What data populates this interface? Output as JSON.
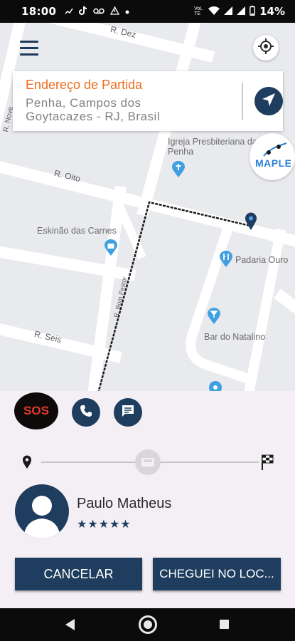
{
  "status_bar": {
    "time": "18:00",
    "left_icons": [
      "signal-bars-icon",
      "tiktok-icon",
      "voicemail-icon",
      "warning-icon",
      "dot-icon"
    ],
    "network": "VoLTE",
    "battery_percent": "14%"
  },
  "map": {
    "street_labels": [
      "R. Dez",
      "R. Oito",
      "R. Seis",
      "R. Nove",
      "R. Bom Pastor"
    ],
    "poi_igreja": "Igreja Presbiteriana da Penha",
    "poi_eskinao": "Eskinão das Carnes",
    "poi_padaria": "Padaria Ouro",
    "poi_bar": "Bar do Natalino",
    "maple_logo_text": "MAPLE"
  },
  "address_card": {
    "title": "Endereço de Partida",
    "address": "Penha, Campos dos Goytacazes - RJ, Brasil"
  },
  "actions": {
    "sos_label": "SOS"
  },
  "driver": {
    "name": "Paulo Matheus",
    "rating_stars": "★★★★★",
    "rating": 5
  },
  "buttons": {
    "cancel": "CANCELAR",
    "arrived": "CHEGUEI NO LOC..."
  },
  "colors": {
    "brand_navy": "#1f3d5e",
    "accent_orange": "#ee6d1f",
    "sos_red": "#e23a2a"
  }
}
